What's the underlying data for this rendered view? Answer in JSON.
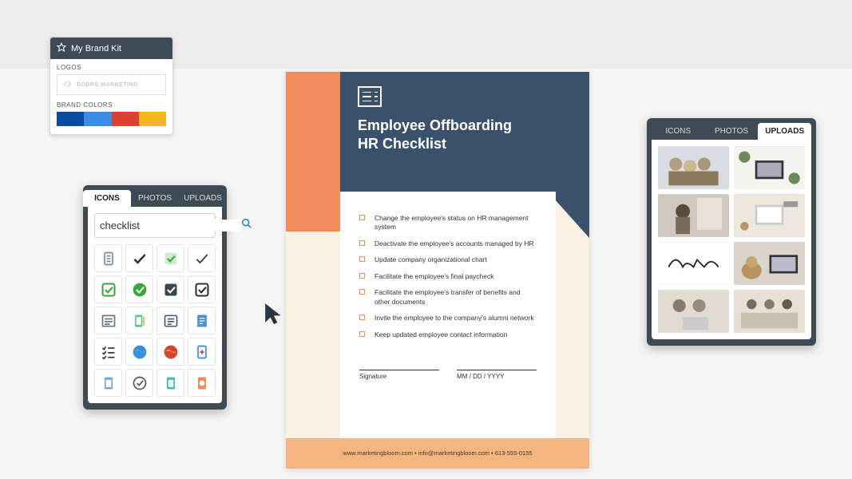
{
  "brandkit": {
    "title": "My Brand Kit",
    "logos_label": "LOGOS",
    "logo_name": "DOBRE MARKETING",
    "colors_label": "BRAND COLORS",
    "colors": [
      "#0a4aa3",
      "#3b8ee6",
      "#d94130",
      "#f4b71e"
    ]
  },
  "icons_panel": {
    "tabs": [
      "ICONS",
      "PHOTOS",
      "UPLOADS"
    ],
    "active_tab": 0,
    "search_value": "checklist",
    "icons": [
      "clipboard-list-icon",
      "checkmark-icon",
      "checkbox-green-icon",
      "checkmark-thin-icon",
      "checkbox-outline-green-icon",
      "check-circle-green-icon",
      "checkbox-dark-icon",
      "checkbox-outline-dark-icon",
      "list-lines-icon",
      "clipboard-pencil-icon",
      "list-card-icon",
      "document-lines-icon",
      "task-list-icon",
      "globe-blue-icon",
      "globe-red-icon",
      "clipboard-plus-icon",
      "clipboard-blue-icon",
      "check-circle-outline-icon",
      "clipboard-teal-icon",
      "clipboard-orange-icon"
    ]
  },
  "doc": {
    "title_line1": "Employee Offboarding",
    "title_line2": "HR Checklist",
    "items": [
      "Change the employee's status on HR management system",
      "Deactivate the employee's accounts managed by HR",
      "Update company organizational chart",
      "Facilitate the employee's final paycheck",
      "Facilitate the employee's transfer of benefits and other documents",
      "Invite the employee to the company's alumni network",
      "Keep updated employee contact information"
    ],
    "signature_label": "Signature",
    "date_label": "MM / DD / YYYY",
    "footer": "www.marketingbloom.com  •  info@marketingbloom.com  •  613-555-0155"
  },
  "uploads_panel": {
    "tabs": [
      "ICONS",
      "PHOTOS",
      "UPLOADS"
    ],
    "active_tab": 2,
    "thumbs": [
      "team-meeting",
      "laptop-desk",
      "woman-window",
      "desk-overhead",
      "signature",
      "laptop-dog",
      "two-people-laptop",
      "group-table"
    ]
  }
}
